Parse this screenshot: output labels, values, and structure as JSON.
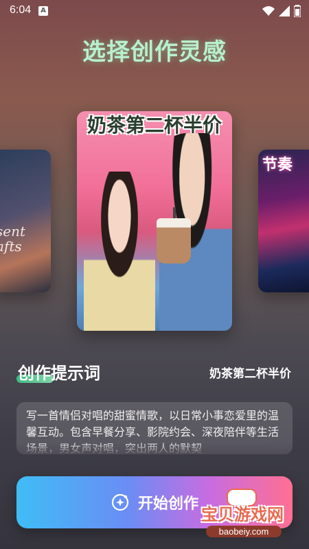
{
  "status_bar": {
    "time": "6:04",
    "app_icon": "A"
  },
  "page_title": "选择创作灵感",
  "carousel": {
    "left_card_text": "sent\nafts",
    "center_card_title": "奶茶第二杯半价",
    "right_card_text": "节奏"
  },
  "prompt": {
    "label": "创作提示词",
    "theme": "奶茶第二杯半价",
    "text": "写一首情侣对唱的甜蜜情歌，以日常小事恋爱里的温馨互动。包含早餐分享、影院约会、深夜陪伴等生活场景，男女声对唱，突出两人的默契"
  },
  "start_button": {
    "label": "开始创作",
    "icon": "sparkle-icon"
  },
  "watermark": {
    "cn": "宝贝游戏网",
    "en": "baobeiy.com"
  },
  "colors": {
    "title": "#b9f0cf",
    "accent_green": "#3cd08a",
    "button_start": "#3fbdf5",
    "button_end": "#ff6f92"
  }
}
